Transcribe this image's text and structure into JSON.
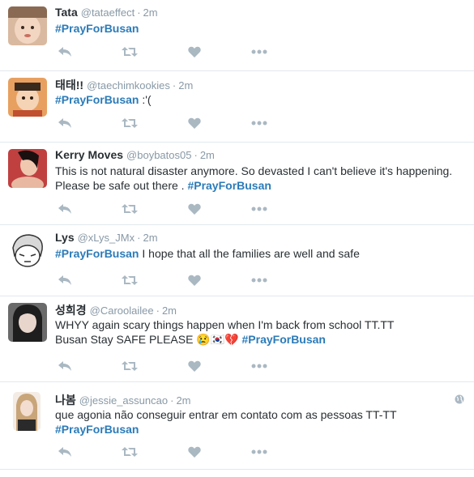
{
  "tweets": [
    {
      "name": "Tata",
      "handle": "@tataeffect",
      "time": "2m",
      "lines": [
        [
          {
            "text": "#PrayForBusan",
            "hashtag": true
          }
        ]
      ]
    },
    {
      "name": "태태!!",
      "handle": "@taechimkookies",
      "time": "2m",
      "lines": [
        [
          {
            "text": "#PrayForBusan",
            "hashtag": true
          },
          {
            "text": " :'(",
            "hashtag": false
          }
        ]
      ]
    },
    {
      "name": "Kerry Moves",
      "handle": "@boybatos05",
      "time": "2m",
      "lines": [
        [
          {
            "text": "This is not natural disaster anymore. So devasted I can't believe it's happening.",
            "hashtag": false
          }
        ],
        [
          {
            "text": "Please be safe out there . ",
            "hashtag": false
          },
          {
            "text": "#PrayForBusan",
            "hashtag": true
          }
        ]
      ]
    },
    {
      "name": "Lys",
      "handle": "@xLys_JMx",
      "time": "2m",
      "lines": [
        [
          {
            "text": "#PrayForBusan",
            "hashtag": true
          },
          {
            "text": " I hope that all the families are well and safe",
            "hashtag": false
          }
        ]
      ]
    },
    {
      "name": "성희경",
      "handle": "@Caroolailee",
      "time": "2m",
      "lines": [
        [
          {
            "text": "WHYY again scary things happen when I'm back from school TT.TT",
            "hashtag": false
          }
        ],
        [
          {
            "text": "Busan Stay SAFE PLEASE 😢🇰🇷💔 ",
            "hashtag": false
          },
          {
            "text": "#PrayForBusan",
            "hashtag": true
          }
        ]
      ]
    },
    {
      "name": "나봄",
      "handle": "@jessie_assuncao",
      "time": "2m",
      "lines": [
        [
          {
            "text": "que agonia não conseguir entrar em contato com as pessoas TT-TT",
            "hashtag": false
          }
        ],
        [
          {
            "text": "#PrayForBusan",
            "hashtag": true
          }
        ]
      ]
    }
  ],
  "icons": {
    "reply": "reply-icon",
    "retweet": "retweet-icon",
    "like": "heart-icon",
    "more": "more-icon",
    "globe": "globe-icon"
  },
  "colors": {
    "name": "#292f33",
    "meta": "#8899a6",
    "hashtag": "#2b7bb9",
    "action": "#aab8c2",
    "divider": "#e1e8ed"
  }
}
